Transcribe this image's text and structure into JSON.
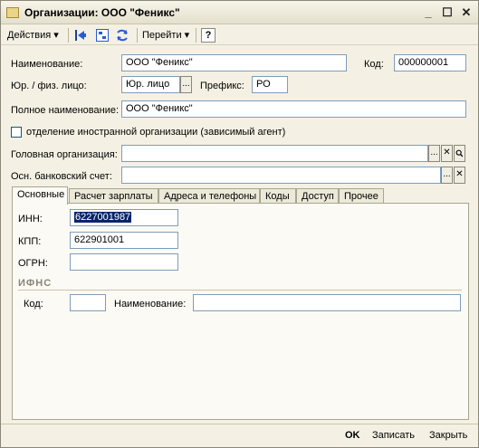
{
  "window": {
    "title": "Организации: ООО \"Феникс\"",
    "controls": {
      "minimize": "_",
      "maximize": "☐",
      "close": "✕"
    }
  },
  "toolbar": {
    "actions_label": "Действия",
    "goto_label": "Перейти",
    "help_label": "?"
  },
  "form": {
    "name_label": "Наименование:",
    "name_value": "ООО \"Феникс\"",
    "code_label": "Код:",
    "code_value": "000000001",
    "entity_type_label": "Юр. / физ. лицо:",
    "entity_type_value": "Юр. лицо",
    "prefix_label": "Префикс:",
    "prefix_value": "РО",
    "full_name_label": "Полное наименование:",
    "full_name_value": "ООО \"Феникс\"",
    "foreign_branch_label": "отделение иностранной организации (зависимый агент)",
    "head_org_label": "Головная организация:",
    "head_org_value": "",
    "bank_account_label": "Осн. банковский счет:",
    "bank_account_value": "",
    "select_glyph": "...",
    "clear_glyph": "✕"
  },
  "tabs": [
    {
      "label": "Основные"
    },
    {
      "label": "Расчет зарплаты"
    },
    {
      "label": "Адреса и телефоны"
    },
    {
      "label": "Коды"
    },
    {
      "label": "Доступ"
    },
    {
      "label": "Прочее"
    }
  ],
  "main_tab": {
    "inn_label": "ИНН:",
    "inn_value": "6227001987",
    "kpp_label": "КПП:",
    "kpp_value": "622901001",
    "ogrn_label": "ОГРН:",
    "ogrn_value": "",
    "ifns_title": "ИФНС",
    "ifns_code_label": "Код:",
    "ifns_code_value": "",
    "ifns_name_label": "Наименование:",
    "ifns_name_value": ""
  },
  "footer": {
    "ok_label": "OK",
    "save_label": "Записать",
    "close_label": "Закрыть"
  }
}
